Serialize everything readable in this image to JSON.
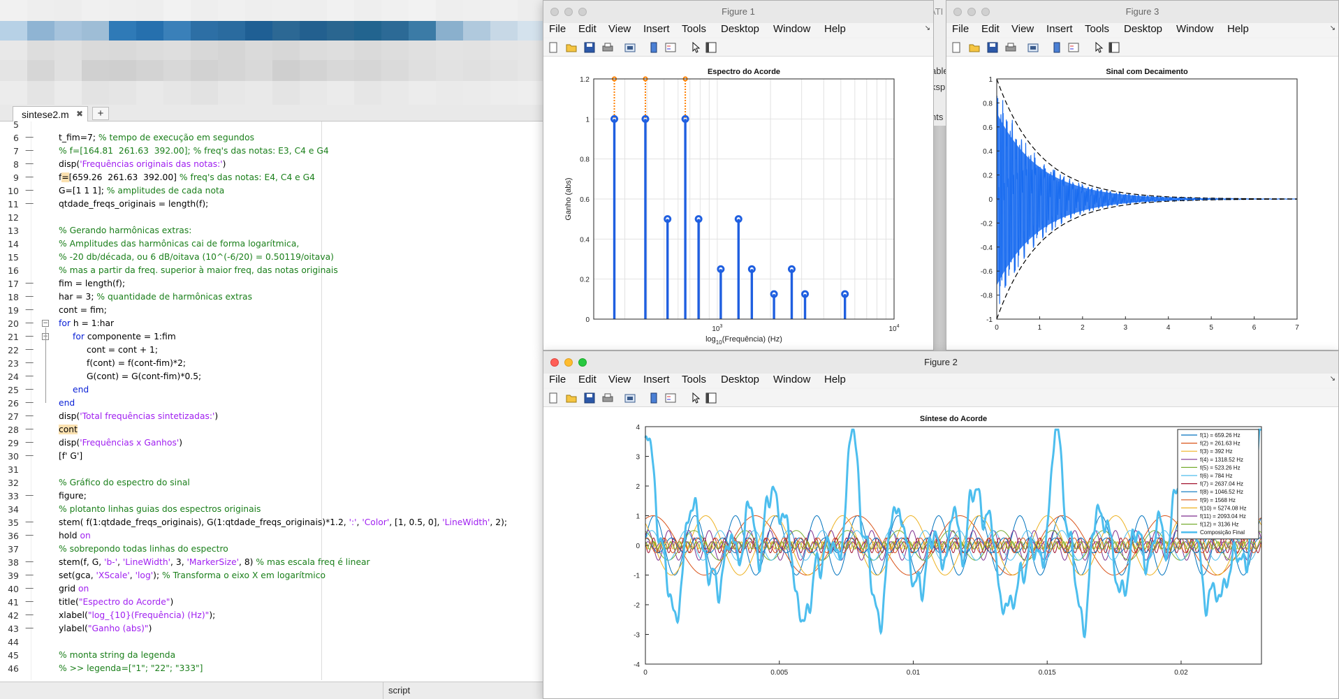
{
  "editor": {
    "tab_label": "sintese2.m",
    "tab_close": "✖",
    "tab_add": "+",
    "status_text": "script",
    "lines": [
      {
        "n": "5",
        "dash": false,
        "fold": "",
        "indent": 0,
        "parts": []
      },
      {
        "n": "6",
        "dash": true,
        "fold": "",
        "indent": 1,
        "parts": [
          [
            "t_fim=7; ",
            ""
          ],
          [
            "% tempo de execução em segundos",
            "cm"
          ]
        ]
      },
      {
        "n": "7",
        "dash": true,
        "fold": "",
        "indent": 1,
        "parts": [
          [
            "% f=[164.81  261.63  392.00]; % freq's das notas: E3, C4 e G4",
            "cm"
          ]
        ]
      },
      {
        "n": "8",
        "dash": true,
        "fold": "",
        "indent": 1,
        "parts": [
          [
            "disp(",
            ""
          ],
          [
            "'Frequências originais das notas:'",
            "str"
          ],
          [
            ")",
            ""
          ]
        ]
      },
      {
        "n": "9",
        "dash": true,
        "fold": "",
        "indent": 1,
        "parts": [
          [
            "f",
            ""
          ],
          [
            "=",
            "hl"
          ],
          [
            "[659.26  261.63  392.00] ",
            ""
          ],
          [
            "% freq's das notas: E4, C4 e G4",
            "cm"
          ]
        ]
      },
      {
        "n": "10",
        "dash": true,
        "fold": "",
        "indent": 1,
        "parts": [
          [
            "G=[1 1 1]; ",
            ""
          ],
          [
            "% amplitudes de cada nota",
            "cm"
          ]
        ]
      },
      {
        "n": "11",
        "dash": true,
        "fold": "",
        "indent": 1,
        "parts": [
          [
            "qtdade_freqs_originais = length(f);",
            ""
          ]
        ]
      },
      {
        "n": "12",
        "dash": false,
        "fold": "",
        "indent": 1,
        "parts": []
      },
      {
        "n": "13",
        "dash": false,
        "fold": "",
        "indent": 1,
        "parts": [
          [
            "% Gerando harmônicas extras:",
            "cm"
          ]
        ]
      },
      {
        "n": "14",
        "dash": false,
        "fold": "",
        "indent": 1,
        "parts": [
          [
            "% Amplitudes das harmônicas cai de forma logarítmica,",
            "cm"
          ]
        ]
      },
      {
        "n": "15",
        "dash": false,
        "fold": "",
        "indent": 1,
        "parts": [
          [
            "% -20 db/década, ou 6 dB/oitava (10^(-6/20) = 0.50119/oitava)",
            "cm"
          ]
        ]
      },
      {
        "n": "16",
        "dash": false,
        "fold": "",
        "indent": 1,
        "parts": [
          [
            "% mas a partir da freq. superior à maior freq, das notas originais",
            "cm"
          ]
        ]
      },
      {
        "n": "17",
        "dash": true,
        "fold": "",
        "indent": 1,
        "parts": [
          [
            "fim = length(f);",
            ""
          ]
        ]
      },
      {
        "n": "18",
        "dash": true,
        "fold": "",
        "indent": 1,
        "parts": [
          [
            "har = 3; ",
            ""
          ],
          [
            "% quantidade de harmônicas extras",
            "cm"
          ]
        ]
      },
      {
        "n": "19",
        "dash": true,
        "fold": "",
        "indent": 1,
        "parts": [
          [
            "cont = fim;",
            ""
          ]
        ]
      },
      {
        "n": "20",
        "dash": true,
        "fold": "−",
        "indent": 1,
        "parts": [
          [
            "for",
            "kw"
          ],
          [
            " h = 1:har",
            ""
          ]
        ]
      },
      {
        "n": "21",
        "dash": true,
        "fold": "−",
        "indent": 2,
        "parts": [
          [
            "for",
            "kw"
          ],
          [
            " componente = 1:fim",
            ""
          ]
        ]
      },
      {
        "n": "22",
        "dash": true,
        "fold": "",
        "indent": 3,
        "parts": [
          [
            "cont = cont + 1;",
            ""
          ]
        ]
      },
      {
        "n": "23",
        "dash": true,
        "fold": "",
        "indent": 3,
        "parts": [
          [
            "f(cont) = f(cont-fim)*2;",
            ""
          ]
        ]
      },
      {
        "n": "24",
        "dash": true,
        "fold": "",
        "indent": 3,
        "parts": [
          [
            "G(cont) = G(cont-fim)*0.5;",
            ""
          ]
        ]
      },
      {
        "n": "25",
        "dash": true,
        "fold": "",
        "indent": 2,
        "parts": [
          [
            "end",
            "kw"
          ]
        ]
      },
      {
        "n": "26",
        "dash": true,
        "fold": "",
        "indent": 1,
        "parts": [
          [
            "end",
            "kw"
          ]
        ]
      },
      {
        "n": "27",
        "dash": true,
        "fold": "",
        "indent": 1,
        "parts": [
          [
            "disp(",
            ""
          ],
          [
            "'Total frequências sintetizadas:'",
            "str"
          ],
          [
            ")",
            ""
          ]
        ]
      },
      {
        "n": "28",
        "dash": true,
        "fold": "",
        "indent": 1,
        "parts": [
          [
            "cont",
            "hl"
          ]
        ]
      },
      {
        "n": "29",
        "dash": true,
        "fold": "",
        "indent": 1,
        "parts": [
          [
            "disp(",
            ""
          ],
          [
            "'Frequências x Ganhos'",
            "str"
          ],
          [
            ")",
            ""
          ]
        ]
      },
      {
        "n": "30",
        "dash": true,
        "fold": "",
        "indent": 1,
        "parts": [
          [
            "[f' G']",
            ""
          ]
        ]
      },
      {
        "n": "31",
        "dash": false,
        "fold": "",
        "indent": 1,
        "parts": []
      },
      {
        "n": "32",
        "dash": false,
        "fold": "",
        "indent": 1,
        "parts": [
          [
            "% Gráfico do espectro do sinal",
            "cm"
          ]
        ]
      },
      {
        "n": "33",
        "dash": true,
        "fold": "",
        "indent": 1,
        "parts": [
          [
            "figure;",
            ""
          ]
        ]
      },
      {
        "n": "34",
        "dash": false,
        "fold": "",
        "indent": 1,
        "parts": [
          [
            "% plotanto linhas guias dos espectros originais",
            "cm"
          ]
        ]
      },
      {
        "n": "35",
        "dash": true,
        "fold": "",
        "indent": 1,
        "parts": [
          [
            "stem( f(1:qtdade_freqs_originais), G(1:qtdade_freqs_originais)*1.2, ",
            ""
          ],
          [
            "':'",
            "str"
          ],
          [
            ", ",
            ""
          ],
          [
            "'Color'",
            "str"
          ],
          [
            ", [1, 0.5, 0], ",
            ""
          ],
          [
            "'LineWidth'",
            "str"
          ],
          [
            ", 2);",
            ""
          ]
        ]
      },
      {
        "n": "36",
        "dash": true,
        "fold": "",
        "indent": 1,
        "parts": [
          [
            "hold ",
            ""
          ],
          [
            "on",
            "str"
          ]
        ]
      },
      {
        "n": "37",
        "dash": false,
        "fold": "",
        "indent": 1,
        "parts": [
          [
            "% sobrepondo todas linhas do espectro",
            "cm"
          ]
        ]
      },
      {
        "n": "38",
        "dash": true,
        "fold": "",
        "indent": 1,
        "parts": [
          [
            "stem(f, G, ",
            ""
          ],
          [
            "'b-'",
            "str"
          ],
          [
            ", ",
            ""
          ],
          [
            "'LineWidth'",
            "str"
          ],
          [
            ", 3, ",
            ""
          ],
          [
            "'MarkerSize'",
            "str"
          ],
          [
            ", 8) ",
            ""
          ],
          [
            "% mas escala freq é linear",
            "cm"
          ]
        ]
      },
      {
        "n": "39",
        "dash": true,
        "fold": "",
        "indent": 1,
        "parts": [
          [
            "set(gca, ",
            ""
          ],
          [
            "'XScale'",
            "str"
          ],
          [
            ", ",
            ""
          ],
          [
            "'log'",
            "str"
          ],
          [
            "); ",
            ""
          ],
          [
            "% Transforma o eixo X em logarítmico",
            "cm"
          ]
        ]
      },
      {
        "n": "40",
        "dash": true,
        "fold": "",
        "indent": 1,
        "parts": [
          [
            "grid ",
            ""
          ],
          [
            "on",
            "str"
          ]
        ]
      },
      {
        "n": "41",
        "dash": true,
        "fold": "",
        "indent": 1,
        "parts": [
          [
            "title(",
            ""
          ],
          [
            "\"Espectro do Acorde\"",
            "str"
          ],
          [
            ")",
            ""
          ]
        ]
      },
      {
        "n": "42",
        "dash": true,
        "fold": "",
        "indent": 1,
        "parts": [
          [
            "xlabel(",
            ""
          ],
          [
            "\"log_{10}(Frequência) (Hz)\"",
            "str"
          ],
          [
            ");",
            ""
          ]
        ]
      },
      {
        "n": "43",
        "dash": true,
        "fold": "",
        "indent": 1,
        "parts": [
          [
            "ylabel(",
            ""
          ],
          [
            "\"Ganho (abs)\"",
            "str"
          ],
          [
            ")",
            ""
          ]
        ]
      },
      {
        "n": "44",
        "dash": false,
        "fold": "",
        "indent": 1,
        "parts": []
      },
      {
        "n": "45",
        "dash": false,
        "fold": "",
        "indent": 1,
        "parts": [
          [
            "% monta string da legenda",
            "cm"
          ]
        ]
      },
      {
        "n": "46",
        "dash": false,
        "fold": "",
        "indent": 1,
        "parts": [
          [
            "% >> legenda=[\"1\"; \"22\"; \"333\"]",
            "cm"
          ]
        ]
      }
    ]
  },
  "figures": {
    "menu": [
      "File",
      "Edit",
      "View",
      "Insert",
      "Tools",
      "Desktop",
      "Window",
      "Help"
    ],
    "fig1": {
      "title": "Figure 1"
    },
    "fig2": {
      "title": "Figure 2"
    },
    "fig3": {
      "title": "Figure 3"
    },
    "partial_text": [
      "ATI",
      "able",
      "ksp",
      "nts"
    ]
  },
  "chart_data": [
    {
      "id": "espectro",
      "type": "stem",
      "title": "Espectro do Acorde",
      "xlabel": "log10(Frequência) (Hz)",
      "xlabel_main": "log",
      "xlabel_sub": "10",
      "xlabel_rest": "(Frequência) (Hz)",
      "ylabel": "Ganho (abs)",
      "xscale": "log",
      "xlim": [
        200,
        10000
      ],
      "ylim": [
        0,
        1.2
      ],
      "yticks": [
        "0",
        "0.2",
        "0.4",
        "0.6",
        "0.8",
        "1",
        "1.2"
      ],
      "xticks": [
        {
          "base": "10",
          "exp": "3",
          "value": 1000
        },
        {
          "base": "10",
          "exp": "4",
          "value": 10000
        }
      ],
      "grid": true,
      "series": [
        {
          "style": "dotted",
          "color": "#ff8000",
          "x": [
            659.26,
            261.63,
            392.0
          ],
          "y": [
            1.2,
            1.2,
            1.2
          ]
        },
        {
          "style": "solid",
          "color": "#1f5fe0",
          "x": [
            659.26,
            261.63,
            392.0,
            1318.52,
            523.26,
            784,
            2637.04,
            1046.52,
            1568,
            5274.08,
            2093.04,
            3136
          ],
          "y": [
            1,
            1,
            1,
            0.5,
            0.5,
            0.5,
            0.25,
            0.25,
            0.25,
            0.125,
            0.125,
            0.125
          ]
        }
      ]
    },
    {
      "id": "decaimento",
      "type": "line",
      "title": "Sinal com Decaimento",
      "xlim": [
        0,
        7
      ],
      "ylim": [
        -1,
        1
      ],
      "xticks": [
        "0",
        "1",
        "2",
        "3",
        "4",
        "5",
        "6",
        "7"
      ],
      "yticks": [
        "-1",
        "-0.8",
        "-0.6",
        "-0.4",
        "-0.2",
        "0",
        "0.2",
        "0.4",
        "0.6",
        "0.8",
        "1"
      ],
      "envelope": "exp(-t)",
      "colors": {
        "signal": "#1a6cf0",
        "envelope": "#000000"
      }
    },
    {
      "id": "sintese",
      "type": "line",
      "title": "Síntese do Acorde",
      "xlim": [
        0,
        0.023
      ],
      "ylim": [
        -4,
        4
      ],
      "xticks": [
        "0",
        "0.005",
        "0.01",
        "0.015",
        "0.02"
      ],
      "yticks": [
        "-4",
        "-3",
        "-2",
        "-1",
        "0",
        "1",
        "2",
        "3",
        "4"
      ],
      "legend_location": "top-right",
      "series": [
        {
          "name": "f(1) = 659.26 Hz",
          "freq": 659.26,
          "amp": 1,
          "color": "#0072bd"
        },
        {
          "name": "f(2) = 261.63 Hz",
          "freq": 261.63,
          "amp": 1,
          "color": "#d95319"
        },
        {
          "name": "f(3) = 392 Hz",
          "freq": 392,
          "amp": 1,
          "color": "#edb120"
        },
        {
          "name": "f(4) = 1318.52 Hz",
          "freq": 1318.52,
          "amp": 0.5,
          "color": "#7e2f8e"
        },
        {
          "name": "f(5) = 523.26 Hz",
          "freq": 523.26,
          "amp": 0.5,
          "color": "#77ac30"
        },
        {
          "name": "f(6) = 784 Hz",
          "freq": 784,
          "amp": 0.5,
          "color": "#4dbeee"
        },
        {
          "name": "f(7) = 2637.04 Hz",
          "freq": 2637.04,
          "amp": 0.25,
          "color": "#a2142f"
        },
        {
          "name": "f(8) = 1046.52 Hz",
          "freq": 1046.52,
          "amp": 0.25,
          "color": "#0072bd"
        },
        {
          "name": "f(9) = 1568 Hz",
          "freq": 1568,
          "amp": 0.25,
          "color": "#d95319"
        },
        {
          "name": "f(10) = 5274.08 Hz",
          "freq": 5274.08,
          "amp": 0.125,
          "color": "#edb120"
        },
        {
          "name": "f(11) = 2093.04 Hz",
          "freq": 2093.04,
          "amp": 0.125,
          "color": "#7e2f8e"
        },
        {
          "name": "f(12) = 3136 Hz",
          "freq": 3136,
          "amp": 0.125,
          "color": "#77ac30"
        },
        {
          "name": "Composição Final",
          "freq": 0,
          "amp": 0,
          "color": "#4dbeee",
          "composite": true
        }
      ]
    }
  ]
}
